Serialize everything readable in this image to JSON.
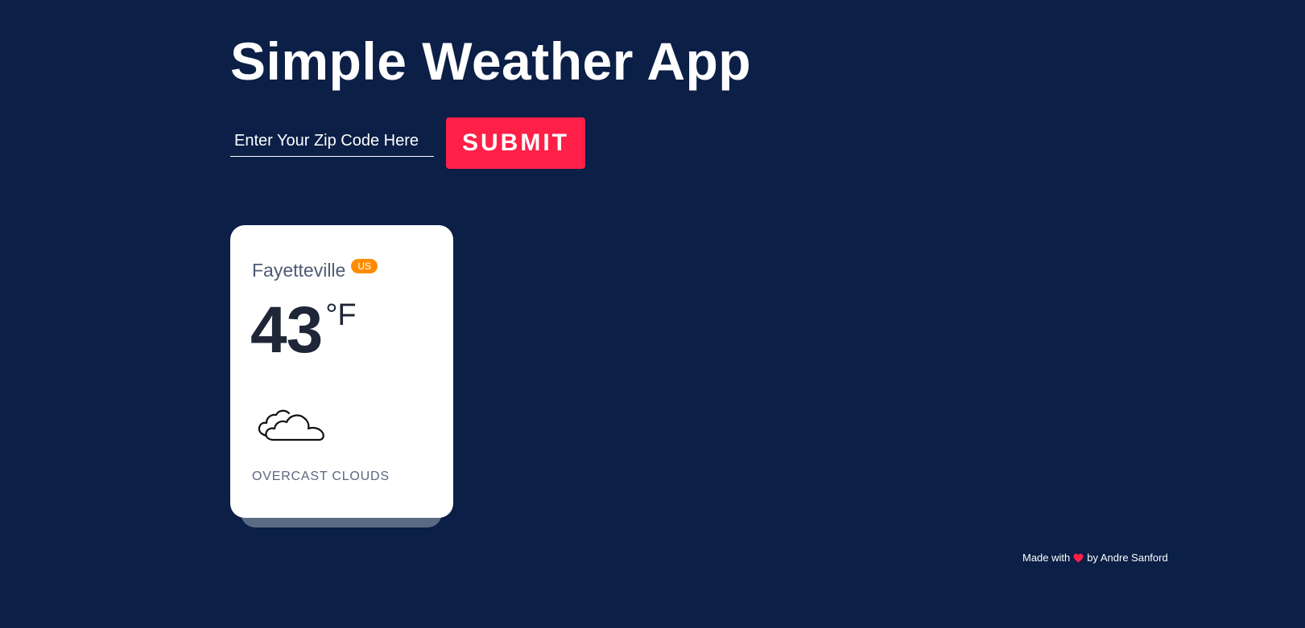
{
  "header": {
    "title": "Simple Weather App"
  },
  "search": {
    "placeholder": "Enter Your Zip Code Here",
    "value": "",
    "submit_label": "SUBMIT"
  },
  "weather_card": {
    "city": "Fayetteville",
    "country": "US",
    "temperature": "43",
    "unit": "°F",
    "icon": "cloud-icon",
    "description": "OVERCAST CLOUDS"
  },
  "footer": {
    "prefix": "Made with",
    "icon": "heart-icon",
    "suffix": "by Andre Sanford"
  },
  "colors": {
    "background": "#0b1f47",
    "accent": "#ff1f47",
    "badge": "#ff8c00",
    "card": "#ffffff"
  }
}
